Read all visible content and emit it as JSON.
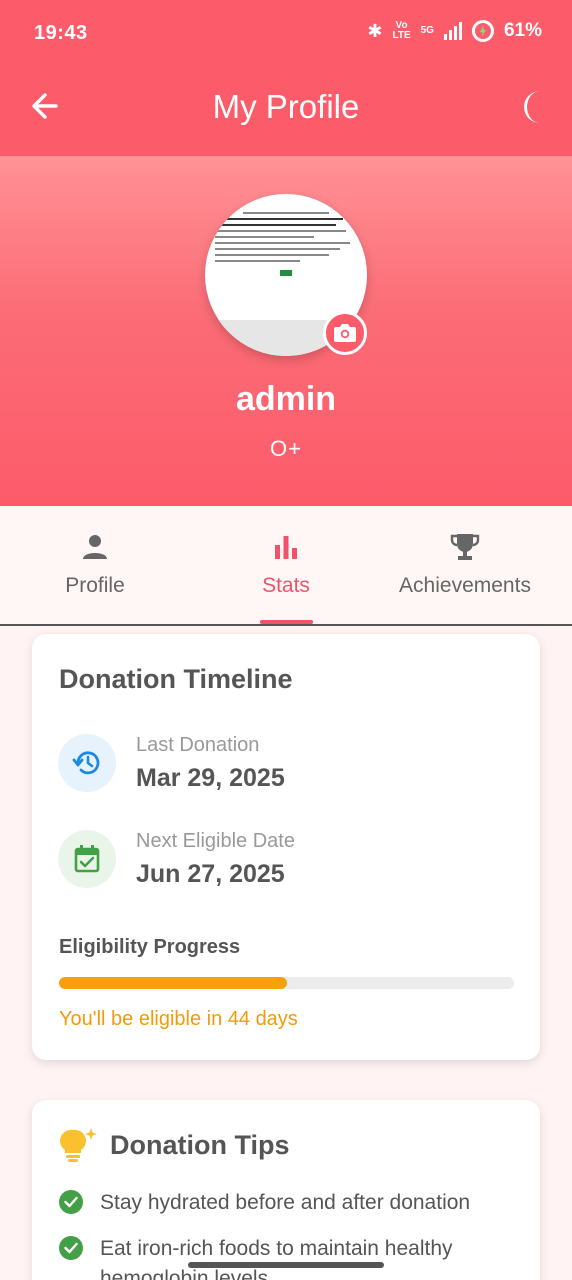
{
  "status_bar": {
    "time": "19:43",
    "network_label_top": "Vo",
    "network_label_bottom": "LTE",
    "network_type": "5G",
    "battery_percent": "61%"
  },
  "app_bar": {
    "title": "My Profile",
    "back_icon": "arrow-back-icon",
    "theme_icon": "moon-icon"
  },
  "profile": {
    "username": "admin",
    "blood_group": "O+",
    "camera_icon": "camera-icon"
  },
  "tabs": [
    {
      "label": "Profile",
      "icon": "person-icon",
      "active": false
    },
    {
      "label": "Stats",
      "icon": "bar-chart-icon",
      "active": true
    },
    {
      "label": "Achievements",
      "icon": "trophy-icon",
      "active": false
    }
  ],
  "timeline": {
    "title": "Donation Timeline",
    "last_donation_label": "Last Donation",
    "last_donation_date": "Mar 29, 2025",
    "next_eligible_label": "Next Eligible Date",
    "next_eligible_date": "Jun 27, 2025",
    "eligibility_title": "Eligibility Progress",
    "progress_fraction": 0.5,
    "eligibility_note": "You'll be eligible in 44 days"
  },
  "tips": {
    "title": "Donation Tips",
    "items": [
      "Stay hydrated before and after donation",
      "Eat iron-rich foods to maintain healthy hemoglobin levels"
    ]
  },
  "colors": {
    "primary": "#fc5b6a",
    "accent_tab": "#f0526a",
    "progress": "#f7a00c",
    "success": "#43a047"
  }
}
